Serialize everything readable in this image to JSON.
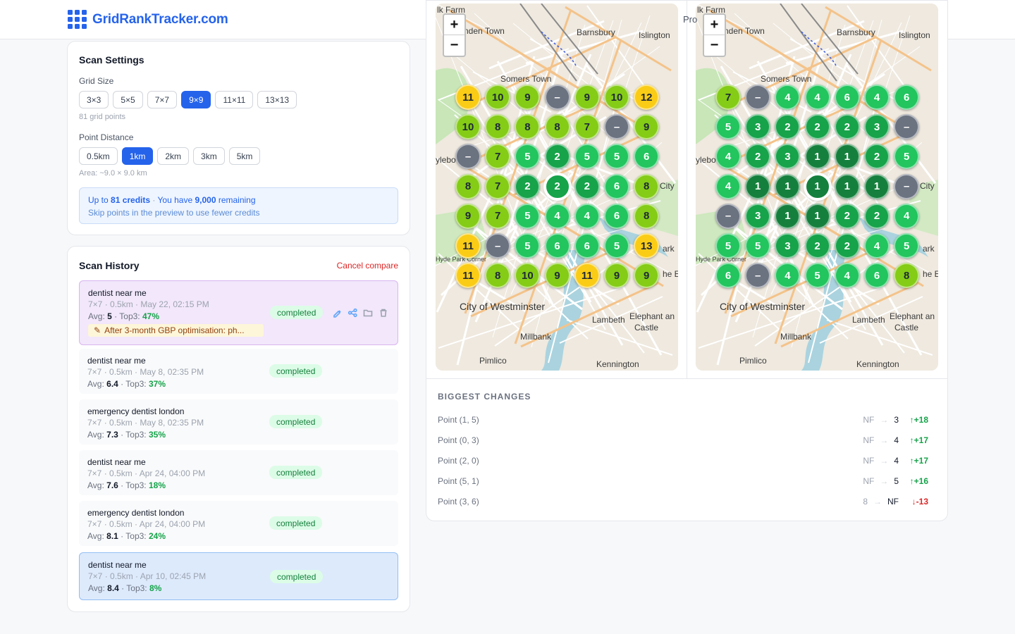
{
  "brand": {
    "name": "GridRankTracker.com"
  },
  "settings": {
    "title": "Scan Settings",
    "grid_size_label": "Grid Size",
    "grid_sizes": [
      "3×3",
      "5×5",
      "7×7",
      "9×9",
      "11×11",
      "13×13"
    ],
    "grid_size_selected": "9×9",
    "grid_points_text": "81 grid points",
    "distance_label": "Point Distance",
    "distances": [
      "0.5km",
      "1km",
      "2km",
      "3km",
      "5km"
    ],
    "distance_selected": "1km",
    "area_text": "Area: ~9.0 × 9.0 km",
    "credits_prefix": "Up to ",
    "credits_amount": "81 credits",
    "credits_sep": " · ",
    "credits_have": "You have ",
    "credits_remaining": "9,000",
    "credits_suffix": " remaining",
    "credits_hint": "Skip points in the preview to use fewer credits"
  },
  "history": {
    "title": "Scan History",
    "cancel_label": "Cancel compare",
    "items": [
      {
        "name": "dentist near me",
        "meta": "7×7 · 0.5km · May 22, 02:15 PM",
        "avg": "5",
        "top3": "47%",
        "status": "completed",
        "note": "After 3-month GBP optimisation: ph...",
        "style": "purple"
      },
      {
        "name": "dentist near me",
        "meta": "7×7 · 0.5km · May 8, 02:35 PM",
        "avg": "6.4",
        "top3": "37%",
        "status": "completed",
        "style": "plain"
      },
      {
        "name": "emergency dentist london",
        "meta": "7×7 · 0.5km · May 8, 02:35 PM",
        "avg": "7.3",
        "top3": "35%",
        "status": "completed",
        "style": "plain"
      },
      {
        "name": "dentist near me",
        "meta": "7×7 · 0.5km · Apr 24, 04:00 PM",
        "avg": "7.6",
        "top3": "18%",
        "status": "completed",
        "style": "plain"
      },
      {
        "name": "emergency dentist london",
        "meta": "7×7 · 0.5km · Apr 24, 04:00 PM",
        "avg": "8.1",
        "top3": "24%",
        "status": "completed",
        "style": "plain"
      },
      {
        "name": "dentist near me",
        "meta": "7×7 · 0.5km · Apr 10, 02:45 PM",
        "avg": "8.4",
        "top3": "8%",
        "status": "completed",
        "style": "blue"
      }
    ],
    "avg_label": "Avg: ",
    "top3_label": " · Top3: "
  },
  "compare": {
    "partial_label": "Pro",
    "map_labels": [
      "lk Farm",
      "nden Town",
      "Barnsbury",
      "Islington",
      "Somers Town",
      "City of Westminster",
      "Lambeth",
      "Elephant an",
      "Castle",
      "Millbank",
      "Pimlico",
      "Kennington",
      "Hyde Park Corner",
      "ylebo",
      "City",
      "ark",
      "he E"
    ],
    "left_grid": [
      [
        "11",
        "10",
        "9",
        "–",
        "9",
        "10",
        "12"
      ],
      [
        "10",
        "8",
        "8",
        "8",
        "7",
        "–",
        "9"
      ],
      [
        "–",
        "7",
        "5",
        "2",
        "5",
        "5",
        "6"
      ],
      [
        "8",
        "7",
        "2",
        "2",
        "2",
        "6",
        "8"
      ],
      [
        "9",
        "7",
        "5",
        "4",
        "4",
        "6",
        "8"
      ],
      [
        "11",
        "–",
        "5",
        "6",
        "6",
        "5",
        "13"
      ],
      [
        "11",
        "8",
        "10",
        "9",
        "11",
        "9",
        "9"
      ]
    ],
    "right_grid": [
      [
        "7",
        "–",
        "4",
        "4",
        "6",
        "4",
        "6"
      ],
      [
        "5",
        "3",
        "2",
        "2",
        "2",
        "3",
        "–"
      ],
      [
        "4",
        "2",
        "3",
        "1",
        "1",
        "2",
        "5"
      ],
      [
        "4",
        "1",
        "1",
        "1",
        "1",
        "1",
        "–"
      ],
      [
        "–",
        "3",
        "1",
        "1",
        "2",
        "2",
        "4"
      ],
      [
        "5",
        "5",
        "3",
        "2",
        "2",
        "4",
        "5"
      ],
      [
        "6",
        "–",
        "4",
        "5",
        "4",
        "6",
        "8"
      ]
    ],
    "colors": {
      "rank1": "#15803d",
      "rank2_3": "#16a34a",
      "rank4_6": "#22c55e",
      "rank7_10": "#84cc16",
      "rank11plus": "#facc15",
      "not_found": "#6b7280"
    },
    "zoom_in": "+",
    "zoom_out": "−"
  },
  "changes": {
    "title": "BIGGEST CHANGES",
    "rows": [
      {
        "point": "Point (1, 5)",
        "from": "NF",
        "to": "3",
        "delta": "↑+18",
        "dir": "up"
      },
      {
        "point": "Point (0, 3)",
        "from": "NF",
        "to": "4",
        "delta": "↑+17",
        "dir": "up"
      },
      {
        "point": "Point (2, 0)",
        "from": "NF",
        "to": "4",
        "delta": "↑+17",
        "dir": "up"
      },
      {
        "point": "Point (5, 1)",
        "from": "NF",
        "to": "5",
        "delta": "↑+16",
        "dir": "up"
      },
      {
        "point": "Point (3, 6)",
        "from": "8",
        "to": "NF",
        "delta": "↓-13",
        "dir": "down"
      }
    ],
    "arrow": "→"
  }
}
